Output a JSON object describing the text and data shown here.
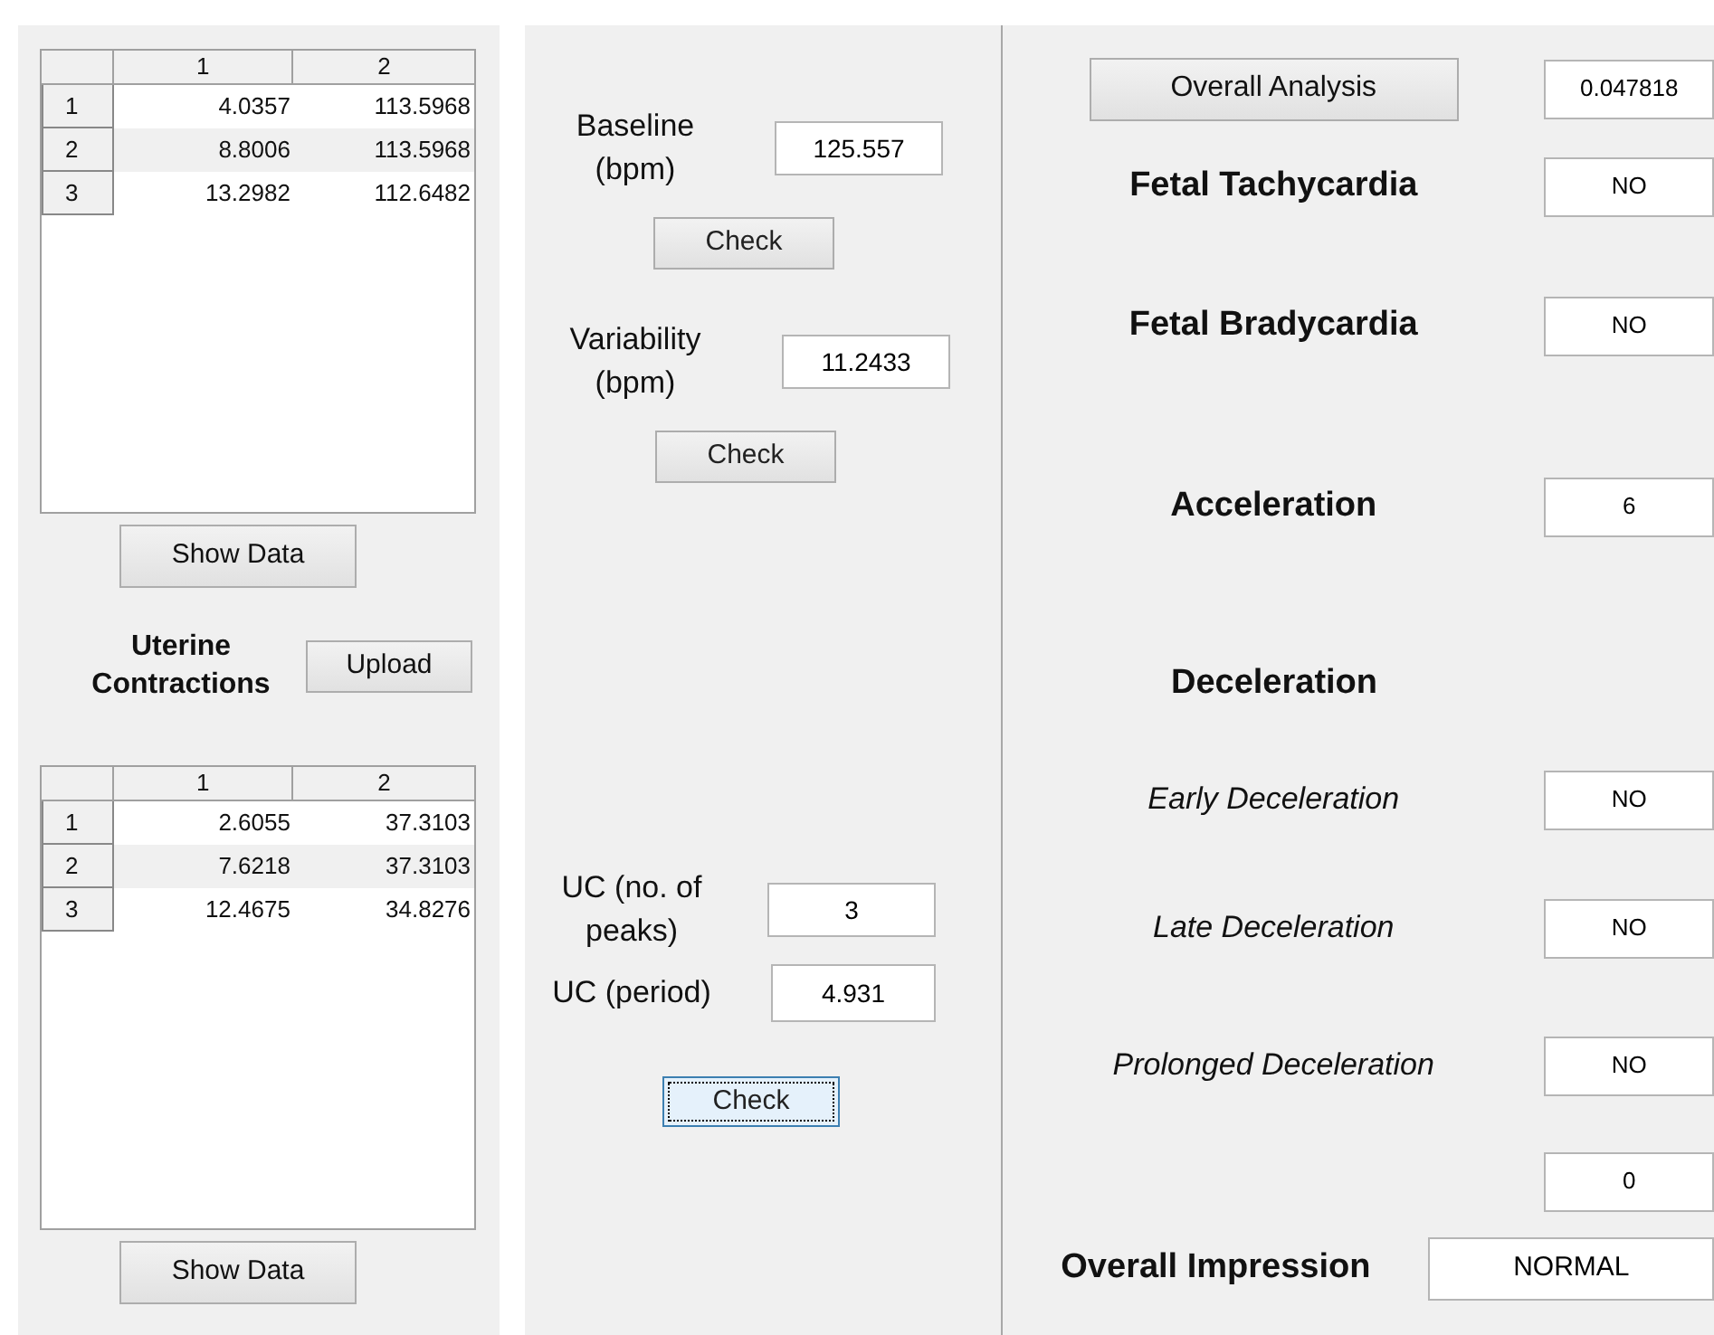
{
  "tables": [
    {
      "columns": [
        "1",
        "2"
      ],
      "rows": [
        {
          "number": "1",
          "cells": [
            "4.0357",
            "113.5968"
          ]
        },
        {
          "number": "2",
          "cells": [
            "8.8006",
            "113.5968"
          ]
        },
        {
          "number": "3",
          "cells": [
            "13.2982",
            "112.6482"
          ]
        }
      ],
      "button": "Show Data"
    },
    {
      "columns": [
        "1",
        "2"
      ],
      "rows": [
        {
          "number": "1",
          "cells": [
            "2.6055",
            "37.3103"
          ]
        },
        {
          "number": "2",
          "cells": [
            "7.6218",
            "37.3103"
          ]
        },
        {
          "number": "3",
          "cells": [
            "12.4675",
            "34.8276"
          ]
        }
      ],
      "button": "Show Data"
    }
  ],
  "upload": {
    "label": "Uterine Contractions",
    "button": "Upload"
  },
  "measures": [
    {
      "label": "Baseline (bpm)",
      "value": "125.557",
      "button": "Check",
      "focused": false
    },
    {
      "label": "Variability (bpm)",
      "value": "11.2433",
      "button": "Check",
      "focused": false
    }
  ],
  "uc": {
    "items": [
      {
        "label": "UC (no. of peaks)",
        "value": "3"
      },
      {
        "label": "UC (period)",
        "value": "4.931"
      }
    ],
    "button": "Check",
    "focused": true
  },
  "results": [
    {
      "kind": "button",
      "label": "Overall Analysis",
      "value": "0.047818"
    },
    {
      "kind": "bold",
      "label": "Fetal Tachycardia",
      "value": "NO"
    },
    {
      "kind": "bold",
      "label": "Fetal Bradycardia",
      "value": "NO"
    },
    {
      "kind": "bold",
      "label": "Acceleration",
      "value": "6"
    },
    {
      "kind": "bold",
      "label": "Deceleration"
    },
    {
      "kind": "italic",
      "label": "Early Deceleration",
      "value": "NO"
    },
    {
      "kind": "italic",
      "label": "Late Deceleration",
      "value": "NO"
    },
    {
      "kind": "italic",
      "label": "Prolonged Deceleration",
      "value": "NO"
    },
    {
      "kind": "none",
      "value": "0"
    }
  ],
  "impression": {
    "label": "Overall Impression",
    "value": "NORMAL"
  }
}
